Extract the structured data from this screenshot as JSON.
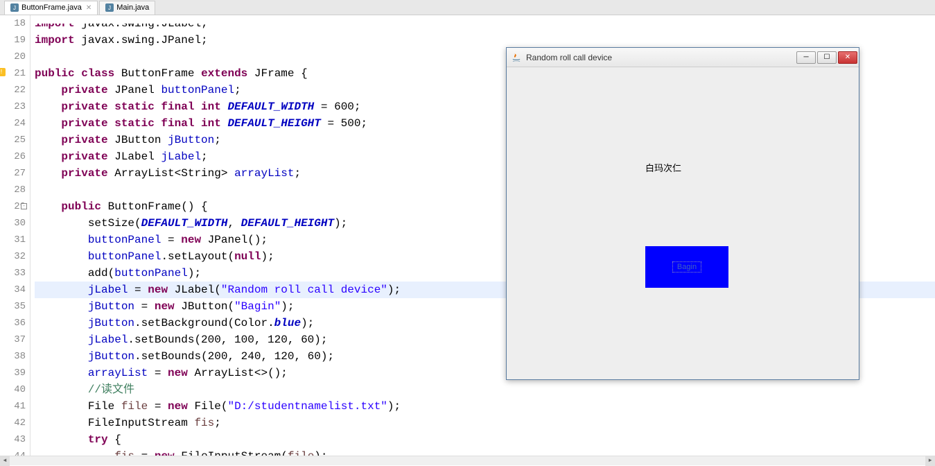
{
  "tabs": [
    {
      "label": "ButtonFrame.java",
      "active": true
    },
    {
      "label": "Main.java",
      "active": false
    }
  ],
  "lines": [
    {
      "num": "18",
      "html": "<span class='kw'>import</span> javax.swing.JLabel;",
      "truncated": true
    },
    {
      "num": "19",
      "html": "<span class='kw'>import</span> javax.swing.JPanel;"
    },
    {
      "num": "20",
      "html": ""
    },
    {
      "num": "21",
      "html": "<span class='kw'>public class</span> <span class='type'>ButtonFrame</span> <span class='kw'>extends</span> JFrame {",
      "warning": true
    },
    {
      "num": "22",
      "html": "    <span class='kw'>private</span> JPanel <span class='field'>buttonPanel</span>;"
    },
    {
      "num": "23",
      "html": "    <span class='kw'>private static final int</span> <span class='static-field'>DEFAULT_WIDTH</span> = 600;"
    },
    {
      "num": "24",
      "html": "    <span class='kw'>private static final int</span> <span class='static-field'>DEFAULT_HEIGHT</span> = 500;"
    },
    {
      "num": "25",
      "html": "    <span class='kw'>private</span> JButton <span class='field'>jButton</span>;"
    },
    {
      "num": "26",
      "html": "    <span class='kw'>private</span> JLabel <span class='field'>jLabel</span>;"
    },
    {
      "num": "27",
      "html": "    <span class='kw'>private</span> ArrayList&lt;String&gt; <span class='field'>arrayList</span>;"
    },
    {
      "num": "28",
      "html": ""
    },
    {
      "num": "29",
      "html": "    <span class='kw'>public</span> ButtonFrame() {",
      "fold": true
    },
    {
      "num": "30",
      "html": "        setSize(<span class='static-field'>DEFAULT_WIDTH</span>, <span class='static-field'>DEFAULT_HEIGHT</span>);"
    },
    {
      "num": "31",
      "html": "        <span class='field'>buttonPanel</span> = <span class='kw'>new</span> JPanel();"
    },
    {
      "num": "32",
      "html": "        <span class='field'>buttonPanel</span>.setLayout(<span class='kw'>null</span>);"
    },
    {
      "num": "33",
      "html": "        add(<span class='field'>buttonPanel</span>);"
    },
    {
      "num": "34",
      "html": "        <span class='field'>jLabel</span> = <span class='kw'>new</span> JLabel(<span class='str'>\"Random roll call device\"</span>);",
      "highlight": true
    },
    {
      "num": "35",
      "html": "        <span class='field'>jButton</span> = <span class='kw'>new</span> JButton(<span class='str'>\"Bagin\"</span>);"
    },
    {
      "num": "36",
      "html": "        <span class='field'>jButton</span>.setBackground(Color.<span class='static-field'>blue</span>);"
    },
    {
      "num": "37",
      "html": "        <span class='field'>jLabel</span>.setBounds(200, 100, 120, 60);"
    },
    {
      "num": "38",
      "html": "        <span class='field'>jButton</span>.setBounds(200, 240, 120, 60);"
    },
    {
      "num": "39",
      "html": "        <span class='field'>arrayList</span> = <span class='kw'>new</span> ArrayList&lt;&gt;();"
    },
    {
      "num": "40",
      "html": "        <span class='comment'>//读文件</span>"
    },
    {
      "num": "41",
      "html": "        File <span class='local'>file</span> = <span class='kw'>new</span> File(<span class='str'>\"D:/studentnamelist.txt\"</span>);"
    },
    {
      "num": "42",
      "html": "        FileInputStream <span class='local'>fis</span>;"
    },
    {
      "num": "43",
      "html": "        <span class='kw'>try</span> {"
    },
    {
      "num": "44",
      "html": "            <span class='local'>fis</span> = <span class='kw'>new</span> FileInputStream(<span class='local'>file</span>);"
    }
  ],
  "swing": {
    "title": "Random roll call device",
    "label_text": "白玛次仁",
    "button_text": "Bagin"
  }
}
